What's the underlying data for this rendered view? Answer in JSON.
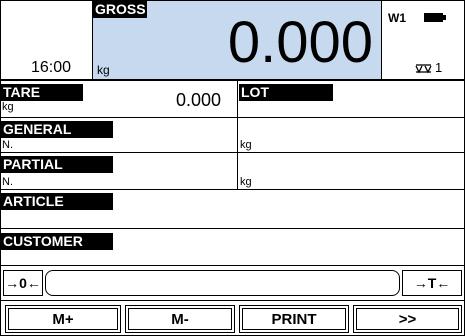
{
  "colors": {
    "gross_bg": "#c7d9ee"
  },
  "header": {
    "time": "16:00",
    "gross_label": "GROSS",
    "gross_unit": "kg",
    "gross_value": "0.000",
    "scale_id": "W1",
    "battery_icon": "battery-icon",
    "platform_icon": "scale-icon",
    "platform_number": "1"
  },
  "tare": {
    "label": "TARE",
    "unit": "kg",
    "value": "0.000"
  },
  "lot": {
    "label": "LOT"
  },
  "general": {
    "label": "GENERAL",
    "n_label": "N.",
    "unit": "kg"
  },
  "partial": {
    "label": "PARTIAL",
    "n_label": "N.",
    "unit": "kg"
  },
  "article": {
    "label": "ARTICLE"
  },
  "customer": {
    "label": "CUSTOMER"
  },
  "controls": {
    "zero_label": "→0←",
    "tare_label": "→T←"
  },
  "softkeys": [
    "M+",
    "M-",
    "PRINT",
    ">>"
  ]
}
